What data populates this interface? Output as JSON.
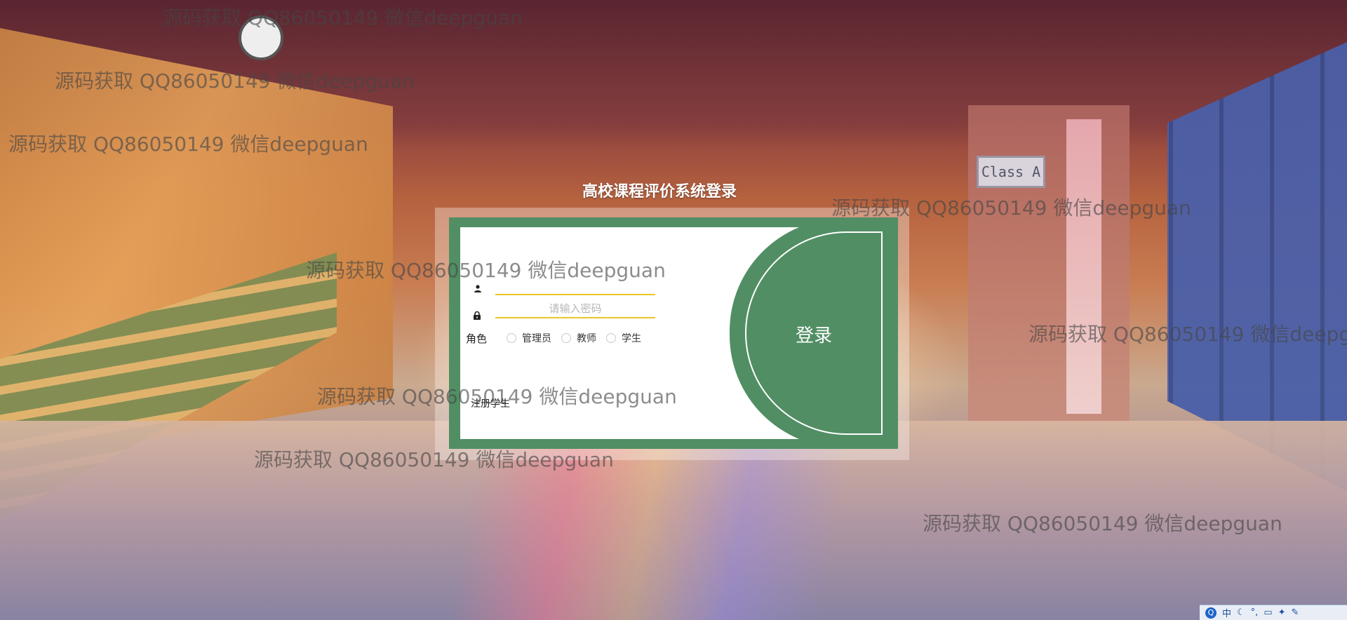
{
  "page": {
    "title": "高校课程评价系统登录"
  },
  "background": {
    "sign_text": "Class A"
  },
  "login": {
    "username_value": "",
    "password_placeholder": "请输入密码",
    "role_label": "角色",
    "roles": [
      "管理员",
      "教师",
      "学生"
    ],
    "register_link": "注册学生",
    "submit_label": "登录"
  },
  "watermark": {
    "text": "源码获取 QQ86050149 微信deepguan"
  },
  "tray": {
    "ime_label": "中"
  },
  "colors": {
    "panel_green": "#518e64",
    "input_underline": "#e8c726"
  }
}
